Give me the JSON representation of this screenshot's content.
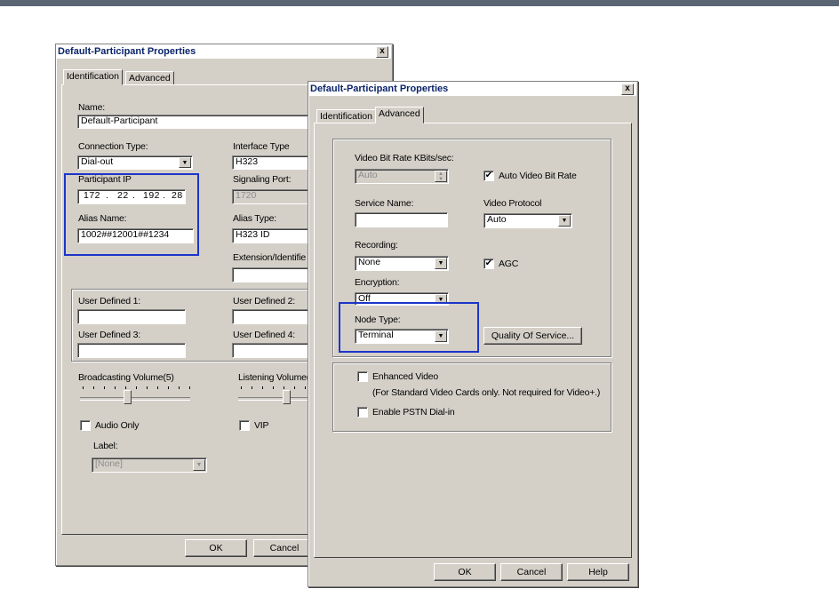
{
  "win1": {
    "title": "Default-Participant Properties",
    "close": "x",
    "tabs": [
      "Identification",
      "Advanced"
    ],
    "name_label": "Name:",
    "name_value": "Default-Participant",
    "connection_type_label": "Connection Type:",
    "connection_type_value": "Dial-out",
    "interface_type_label": "Interface Type",
    "interface_type_value": "H323",
    "participant_ip_label": "Participant IP",
    "ip": [
      "172",
      "22",
      "192",
      "28"
    ],
    "ip_sep": ".",
    "signaling_port_label": "Signaling Port:",
    "signaling_port_value": "1720",
    "alias_name_label": "Alias Name:",
    "alias_name_value": "1002##12001##1234",
    "alias_type_label": "Alias Type:",
    "alias_type_value": "H323 ID",
    "extension_label": "Extension/Identifie",
    "user_defined_1": "User Defined 1:",
    "user_defined_2": "User Defined 2:",
    "user_defined_3": "User Defined 3:",
    "user_defined_4": "User Defined 4:",
    "broadcasting_volume": "Broadcasting Volume(5)",
    "listening_volume": "Listening Volume(",
    "audio_only": "Audio Only",
    "vip": "VIP",
    "label_label": "Label:",
    "label_value": "[None]",
    "ok": "OK",
    "cancel": "Cancel"
  },
  "win2": {
    "title": "Default-Participant Properties",
    "close": "x",
    "tabs": [
      "Identification",
      "Advanced"
    ],
    "video_bit_rate_label": "Video Bit Rate KBits/sec:",
    "video_bit_rate_value": "Auto",
    "auto_video_bit_rate": "Auto Video Bit Rate",
    "auto_video_bit_rate_checked": true,
    "service_name_label": "Service Name:",
    "service_name_value": "",
    "video_protocol_label": "Video Protocol",
    "video_protocol_value": "Auto",
    "recording_label": "Recording:",
    "recording_value": "None",
    "agc": "AGC",
    "agc_checked": true,
    "encryption_label": "Encryption:",
    "encryption_value": "Off",
    "node_type_label": "Node Type:",
    "node_type_value": "Terminal",
    "quality_of_service": "Quality Of Service...",
    "enhanced_video": "Enhanced Video",
    "enhanced_video_note": "(For Standard Video Cards only. Not required for Video+.)",
    "enable_pstn": "Enable PSTN Dial-in",
    "ok": "OK",
    "cancel": "Cancel",
    "help": "Help"
  },
  "colors": {
    "highlight": "#1c35c9",
    "dialog_bg": "#d4d0c8",
    "title_text": "#0a246a"
  }
}
